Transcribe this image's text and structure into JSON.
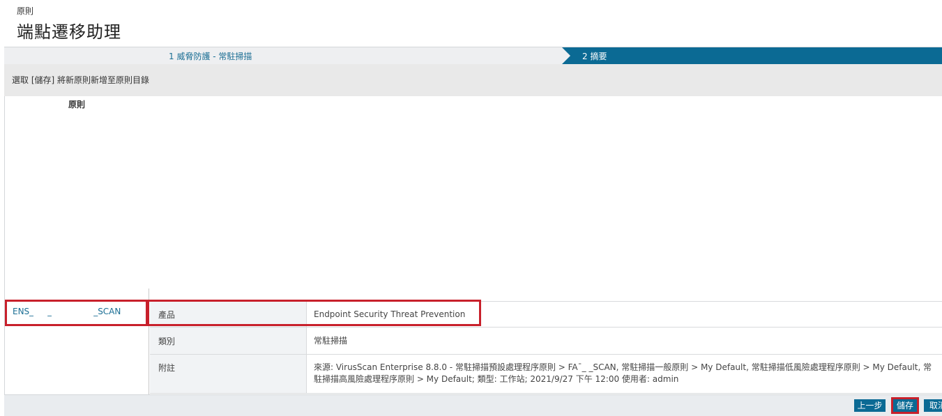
{
  "header": {
    "breadcrumb": "原則",
    "title": "端點遷移助理"
  },
  "wizard": {
    "step1_label": "1 威脅防護 - 常駐掃描",
    "step2_label": "2 摘要"
  },
  "instruction": "選取 [儲存] 將新原則新增至原則目錄",
  "policy_list": {
    "header": "原則",
    "item_prefix": "ENS_",
    "item_mid": "_",
    "item_suffix": "_SCAN"
  },
  "details": {
    "rows": [
      {
        "label": "產品",
        "value": "Endpoint Security Threat Prevention"
      },
      {
        "label": "類別",
        "value": "常駐掃描"
      },
      {
        "label": "附註",
        "value": "來源: VirusScan Enterprise 8.8.0 - 常駐掃描預設處理程序原則 > FA¯_          _SCAN, 常駐掃描一般原則 > My Default, 常駐掃描低風險處理程序原則 > My Default, 常駐掃描高風險處理程序原則 > My Default; 類型: 工作站; 2021/9/27 下午 12:00 使用者: admin"
      }
    ]
  },
  "buttons": {
    "prev": "上一步",
    "save": "儲存",
    "cancel": "取消"
  },
  "colors": {
    "accent": "#0b6a94",
    "highlight": "#c8202b",
    "link": "#1a6e94"
  }
}
